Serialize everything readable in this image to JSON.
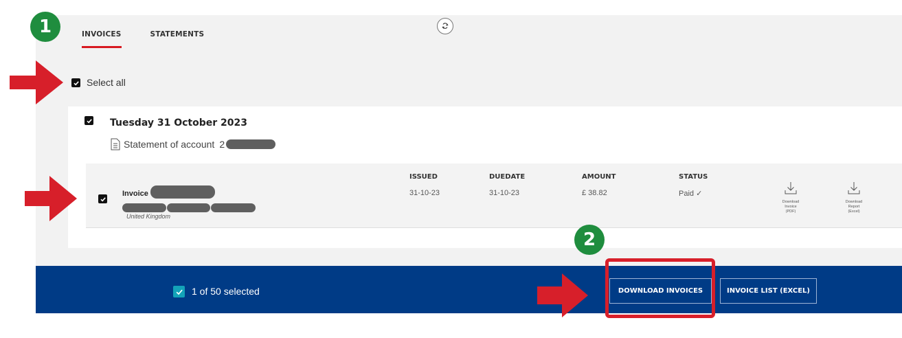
{
  "tabs": [
    {
      "label": "INVOICES",
      "active": true
    },
    {
      "label": "STATEMENTS",
      "active": false
    }
  ],
  "refresh_icon": "refresh-icon",
  "select_all": {
    "label": "Select all",
    "checked": true
  },
  "group": {
    "date": "Tuesday 31 October 2023",
    "statement_label": "Statement of account",
    "statement_prefix": "2"
  },
  "invoice": {
    "name_label": "Invoice",
    "country": "United Kingdom",
    "columns": [
      {
        "header": "ISSUED",
        "value": "31-10-23"
      },
      {
        "header": "DUEDATE",
        "value": "31-10-23"
      },
      {
        "header": "AMOUNT",
        "value": "£ 38.82"
      },
      {
        "header": "STATUS",
        "value": "Paid ✓"
      }
    ],
    "downloads": [
      {
        "lines": [
          "Download",
          "Invoice",
          "(PDF)"
        ]
      },
      {
        "lines": [
          "Download",
          "Report",
          "(Excel)"
        ]
      }
    ]
  },
  "bottom_bar": {
    "selected_text": "1 of 50 selected",
    "download_button": "DOWNLOAD INVOICES",
    "excel_button": "INVOICE LIST (EXCEL)"
  },
  "annotations": {
    "badge_1": "1",
    "badge_2": "2"
  },
  "colors": {
    "accent_red": "#d71920",
    "bar_blue": "#003b86",
    "badge_green": "#1f8d3e",
    "check_teal": "#13a3b8"
  }
}
